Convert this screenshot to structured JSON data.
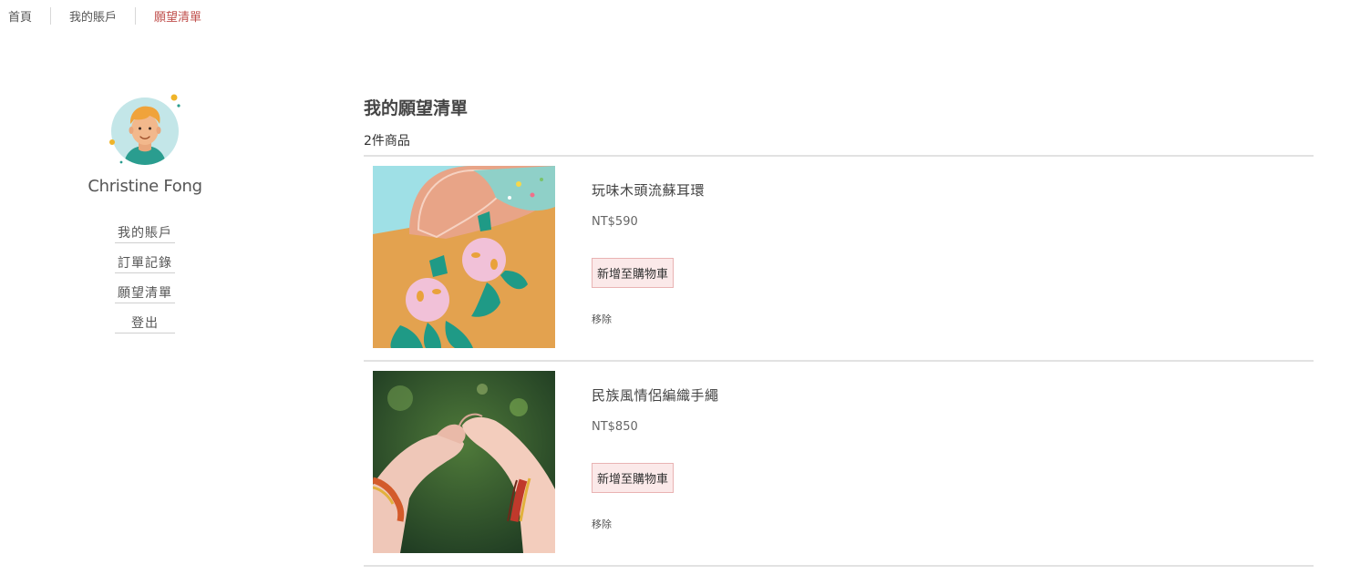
{
  "breadcrumb": {
    "items": [
      {
        "label": "首頁"
      },
      {
        "label": "我的賬戶"
      },
      {
        "label": "願望清單"
      }
    ]
  },
  "sidebar": {
    "user_name": "Christine Fong",
    "menu": [
      {
        "label": "我的賬戶"
      },
      {
        "label": "訂單記錄"
      },
      {
        "label": "願望清單"
      },
      {
        "label": "登出"
      }
    ]
  },
  "main": {
    "title": "我的願望清單",
    "count": "2件商品",
    "items": [
      {
        "name": "玩味木頭流蘇耳環",
        "price": "NT$590",
        "add_to_cart": "新增至購物車",
        "remove": "移除"
      },
      {
        "name": "民族風情侶編織手繩",
        "price": "NT$850",
        "add_to_cart": "新增至購物車",
        "remove": "移除"
      }
    ]
  },
  "colors": {
    "accent": "#c0504d",
    "button_bg": "#fbe9e9",
    "button_border": "#e9b3b3",
    "divider": "#e2e2e2"
  },
  "icons": [
    "avatar-illustration"
  ]
}
